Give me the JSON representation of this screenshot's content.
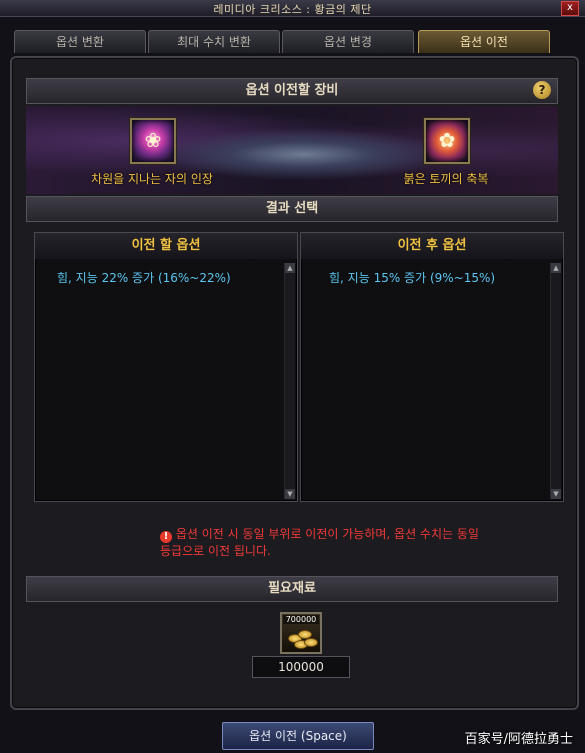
{
  "window": {
    "title": "레미디아 크리소스 : 황금의 제단",
    "close_label": "x"
  },
  "tabs": [
    {
      "label": "옵션 변환",
      "active": false
    },
    {
      "label": "최대 수치 변환",
      "active": false
    },
    {
      "label": "옵션 변경",
      "active": false
    },
    {
      "label": "옵션 이전",
      "active": true
    }
  ],
  "equipment_section": {
    "title": "옵션 이전할 장비",
    "help_label": "?",
    "source_item": {
      "name": "차원을 지나는 자의 인장",
      "icon": "seal-icon"
    },
    "target_item": {
      "name": "붉은 토끼의 축복",
      "icon": "blessing-icon"
    }
  },
  "result_section": {
    "title": "결과 선택",
    "before": {
      "header": "이전 할 옵션",
      "value": "힘, 지능 22% 증가 (16%~22%)"
    },
    "after": {
      "header": "이전 후 옵션",
      "value": "힘, 지능 15% 증가 (9%~15%)"
    }
  },
  "warning": {
    "icon": "!",
    "text": "옵션 이전 시 동일 부위로 이전이 가능하며, 옵션 수치는 동일 등급으로 이전 됩니다."
  },
  "materials_section": {
    "title": "필요재료",
    "item_count": "700000",
    "item_icon": "gold-coins-icon",
    "required_amount": "100000"
  },
  "action_button": {
    "label": "옵션 이전 (Space)"
  },
  "watermark": "百家号/阿德拉勇士",
  "colors": {
    "gold_text": "#f0c040",
    "option_text": "#5cc6f0",
    "warning_text": "#f03a3a",
    "active_tab": "#6b5a34"
  }
}
